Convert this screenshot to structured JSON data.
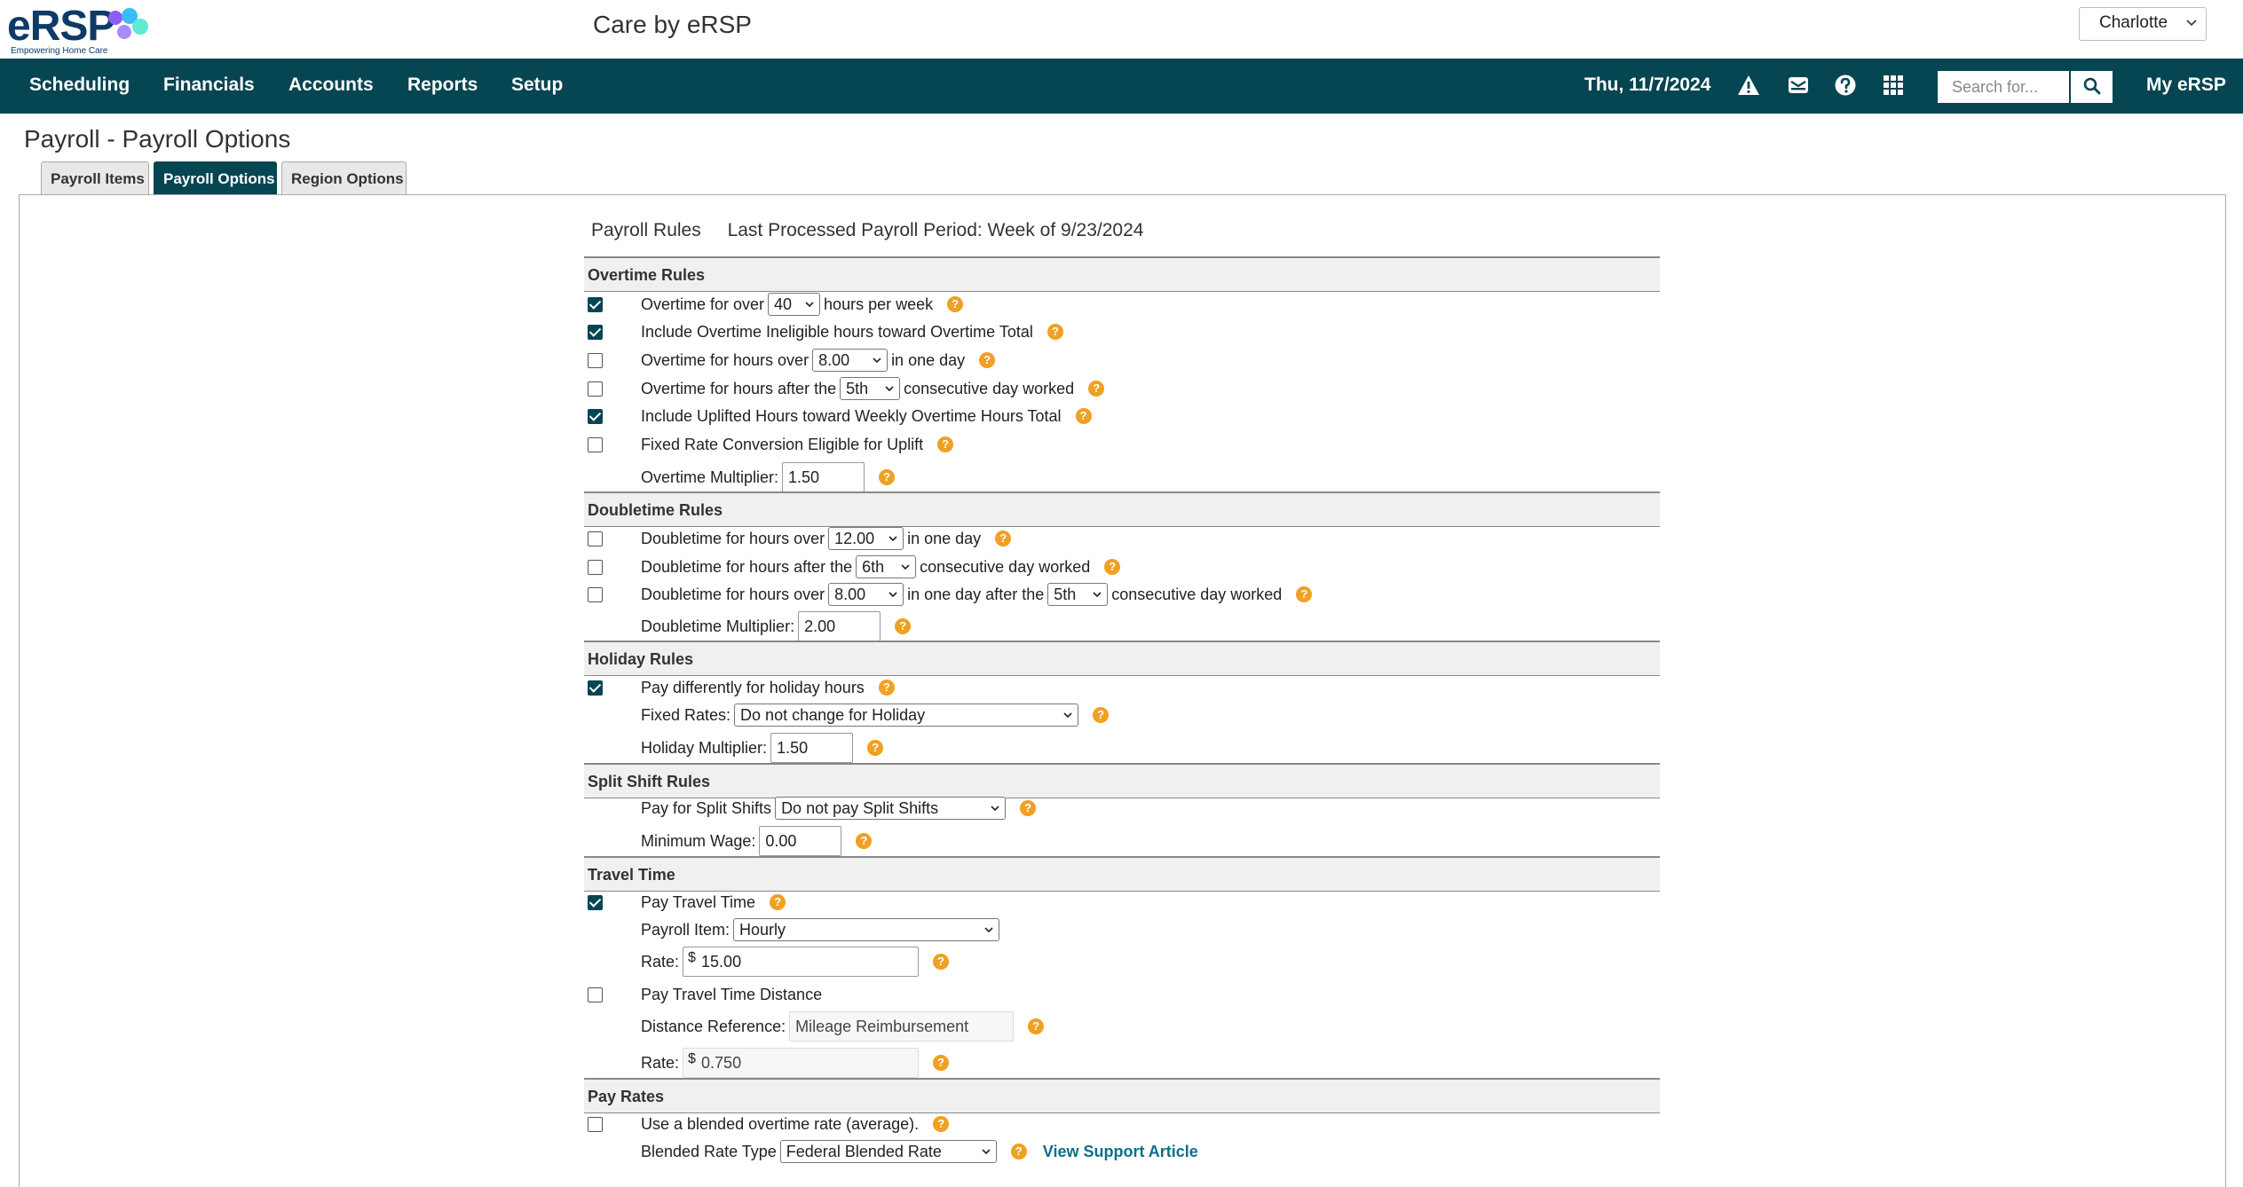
{
  "header": {
    "logo_text": "eRSP",
    "logo_tagline": "Empowering Home Care",
    "app_title": "Care by eRSP",
    "user_name": "Charlotte"
  },
  "nav": {
    "items": [
      "Scheduling",
      "Financials",
      "Accounts",
      "Reports",
      "Setup"
    ],
    "date": "Thu, 11/7/2024",
    "search_placeholder": "Search for...",
    "my_ersp": "My eRSP",
    "icons": [
      "warning-icon",
      "mail-icon",
      "help-circle-icon",
      "apps-grid-icon",
      "search-icon"
    ]
  },
  "page": {
    "title": "Payroll - Payroll Options",
    "tabs": [
      {
        "label": "Payroll Items",
        "active": false
      },
      {
        "label": "Payroll Options",
        "active": true
      },
      {
        "label": "Region Options",
        "active": false
      }
    ],
    "rules_title": "Payroll Rules",
    "last_processed": "Last Processed Payroll Period: Week of 9/23/2024"
  },
  "overtime": {
    "title": "Overtime Rules",
    "r1": {
      "checked": true,
      "pre": "Overtime for over",
      "value": "40",
      "post": "hours per week"
    },
    "r2": {
      "checked": true,
      "label": "Include Overtime Ineligible hours toward Overtime Total"
    },
    "r3": {
      "checked": false,
      "pre": "Overtime for hours over",
      "value": "8.00",
      "post": "in one day"
    },
    "r4": {
      "checked": false,
      "pre": "Overtime for hours after the",
      "value": "5th",
      "post": "consecutive day worked"
    },
    "r5": {
      "checked": true,
      "label": "Include Uplifted Hours toward Weekly Overtime Hours Total"
    },
    "r6": {
      "checked": false,
      "label": "Fixed Rate Conversion Eligible for Uplift"
    },
    "multiplier_label": "Overtime Multiplier:",
    "multiplier": "1.50"
  },
  "doubletime": {
    "title": "Doubletime Rules",
    "r1": {
      "checked": false,
      "pre": "Doubletime for hours over",
      "value": "12.00",
      "post": "in one day"
    },
    "r2": {
      "checked": false,
      "pre": "Doubletime for hours after the",
      "value": "6th",
      "post": "consecutive day worked"
    },
    "r3": {
      "checked": false,
      "pre": "Doubletime for hours over",
      "value": "8.00",
      "mid": "in one day after the",
      "value2": "5th",
      "post": "consecutive day worked"
    },
    "multiplier_label": "Doubletime Multiplier:",
    "multiplier": "2.00"
  },
  "holiday": {
    "title": "Holiday Rules",
    "r1": {
      "checked": true,
      "label": "Pay differently for holiday hours"
    },
    "fixed_label": "Fixed Rates:",
    "fixed_value": "Do not change for Holiday",
    "multiplier_label": "Holiday Multiplier:",
    "multiplier": "1.50"
  },
  "split": {
    "title": "Split Shift Rules",
    "pay_label": "Pay for Split Shifts",
    "pay_value": "Do not pay Split Shifts",
    "wage_label": "Minimum Wage:",
    "wage": "0.00"
  },
  "travel": {
    "title": "Travel Time",
    "r1": {
      "checked": true,
      "label": "Pay Travel Time"
    },
    "item_label": "Payroll Item:",
    "item_value": "Hourly",
    "rate_label": "Rate:",
    "rate": "15.00",
    "r2": {
      "checked": false,
      "label": "Pay Travel Time Distance"
    },
    "distance_label": "Distance Reference:",
    "distance_value": "Mileage Reimbursement",
    "rate2_label": "Rate:",
    "rate2": "0.750",
    "currency": "$"
  },
  "payrates": {
    "title": "Pay Rates",
    "r1": {
      "checked": false,
      "label": "Use a blended overtime rate (average)."
    },
    "blend_label": "Blended Rate Type",
    "blend_value": "Federal Blended Rate",
    "support_link": "View Support Article"
  },
  "help_glyph": "?"
}
